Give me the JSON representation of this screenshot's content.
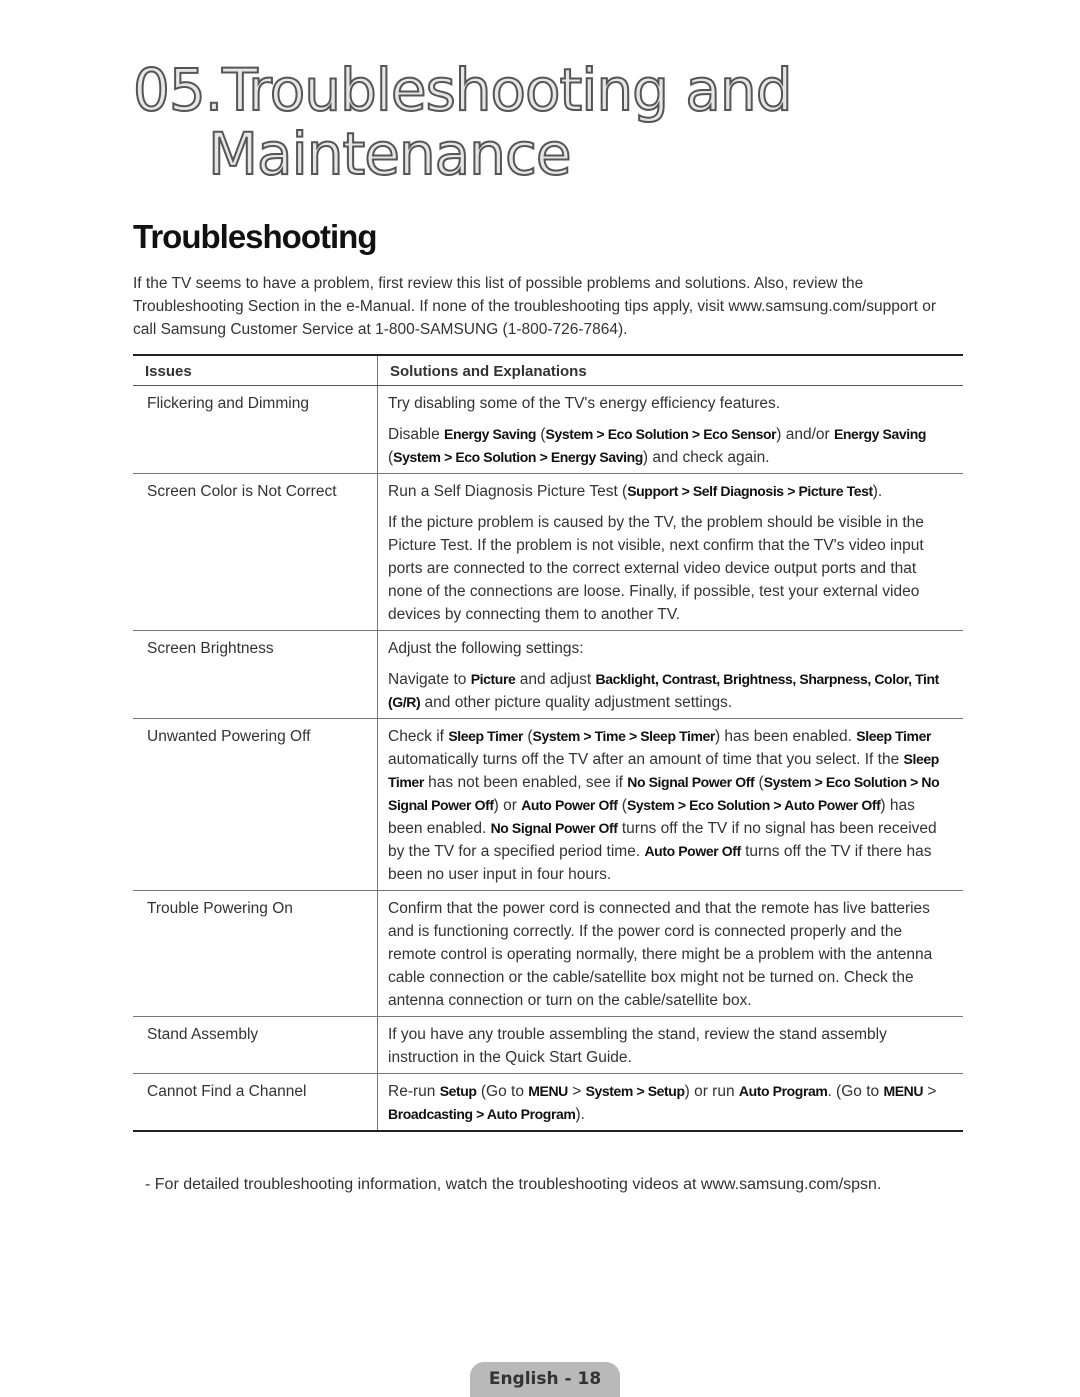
{
  "title": {
    "line1": "05.Troubleshooting and",
    "line2": "Maintenance"
  },
  "section_heading": "Troubleshooting",
  "intro": "If the TV seems to have a problem, first review this list of possible problems and solutions. Also, review the Troubleshooting Section in the e-Manual. If none of the troubleshooting tips apply, visit www.samsung.com/support or call Samsung Customer Service at 1-800-SAMSUNG (1-800-726-7864).",
  "table": {
    "headers": [
      "Issues",
      "Solutions and Explanations"
    ],
    "rows": [
      {
        "issue": "Flickering and Dimming",
        "paragraphs": [
          [
            {
              "t": "Try disabling some of the TV's energy efficiency features."
            }
          ],
          [
            {
              "t": "Disable "
            },
            {
              "t": "Energy Saving",
              "b": true
            },
            {
              "t": " ("
            },
            {
              "t": "System > Eco Solution > Eco Sensor",
              "b": true
            },
            {
              "t": ") and/or "
            },
            {
              "t": "Energy Saving",
              "b": true
            },
            {
              "t": " ("
            },
            {
              "t": "System > Eco Solution > Energy Saving",
              "b": true
            },
            {
              "t": ") and check again."
            }
          ]
        ]
      },
      {
        "issue": "Screen Color is Not Correct",
        "paragraphs": [
          [
            {
              "t": "Run a Self Diagnosis Picture Test ("
            },
            {
              "t": "Support > Self Diagnosis > Picture Test",
              "b": true
            },
            {
              "t": ")."
            }
          ],
          [
            {
              "t": "If the picture problem is caused by the TV, the problem should be visible in the Picture Test. If the problem is not visible, next confirm that the TV's video input ports are connected to the correct external video device output ports and that none of the connections are loose. Finally, if possible, test your external video devices by connecting them to another TV."
            }
          ]
        ]
      },
      {
        "issue": "Screen Brightness",
        "paragraphs": [
          [
            {
              "t": "Adjust the following settings:"
            }
          ],
          [
            {
              "t": "Navigate to "
            },
            {
              "t": "Picture",
              "b": true
            },
            {
              "t": " and adjust "
            },
            {
              "t": "Backlight, Contrast, Brightness, Sharpness, Color, Tint (G/R)",
              "b": true
            },
            {
              "t": " and other picture quality adjustment settings."
            }
          ]
        ]
      },
      {
        "issue": "Unwanted Powering Off",
        "paragraphs": [
          [
            {
              "t": "Check if "
            },
            {
              "t": "Sleep Timer",
              "b": true
            },
            {
              "t": " ("
            },
            {
              "t": "System > Time > Sleep Timer",
              "b": true
            },
            {
              "t": ") has been enabled. "
            },
            {
              "t": "Sleep Timer",
              "b": true
            },
            {
              "t": " automatically turns off the TV after an amount of time that you select. If the "
            },
            {
              "t": "Sleep Timer",
              "b": true
            },
            {
              "t": " has not been enabled, see if "
            },
            {
              "t": "No Signal Power Off",
              "b": true
            },
            {
              "t": " ("
            },
            {
              "t": "System > Eco Solution > No Signal Power Off",
              "b": true
            },
            {
              "t": ") or "
            },
            {
              "t": "Auto Power Off",
              "b": true
            },
            {
              "t": " ("
            },
            {
              "t": "System > Eco Solution > Auto Power Off",
              "b": true
            },
            {
              "t": ") has been enabled. "
            },
            {
              "t": "No Signal Power Off",
              "b": true
            },
            {
              "t": " turns off the TV if no signal has been received by the TV for a specified period time. "
            },
            {
              "t": "Auto Power Off",
              "b": true
            },
            {
              "t": " turns off the TV if there has been no user input in four hours."
            }
          ]
        ]
      },
      {
        "issue": "Trouble Powering On",
        "paragraphs": [
          [
            {
              "t": "Confirm that the power cord is connected and that the remote has live batteries and is functioning correctly. If the power cord is connected properly and the remote control is operating normally, there might be a problem with the antenna cable connection or the cable/satellite box might not be turned on. Check the antenna connection or turn on the cable/satellite box."
            }
          ]
        ]
      },
      {
        "issue": "Stand Assembly",
        "paragraphs": [
          [
            {
              "t": "If you have any trouble assembling the stand, review the stand assembly instruction in the Quick Start Guide."
            }
          ]
        ]
      },
      {
        "issue": "Cannot Find a Channel",
        "paragraphs": [
          [
            {
              "t": "Re-run "
            },
            {
              "t": "Setup",
              "b": true
            },
            {
              "t": " (Go to "
            },
            {
              "t": "MENU",
              "b": true
            },
            {
              "t": " > "
            },
            {
              "t": "System > Setup",
              "b": true
            },
            {
              "t": ") or run "
            },
            {
              "t": "Auto Program",
              "b": true
            },
            {
              "t": ". (Go to "
            },
            {
              "t": "MENU",
              "b": true
            },
            {
              "t": " > "
            },
            {
              "t": "Broadcasting > Auto Program",
              "b": true
            },
            {
              "t": ")."
            }
          ]
        ]
      }
    ]
  },
  "note": "-   For detailed troubleshooting information, watch the troubleshooting videos at www.samsung.com/spsn.",
  "footer": "English - 18"
}
